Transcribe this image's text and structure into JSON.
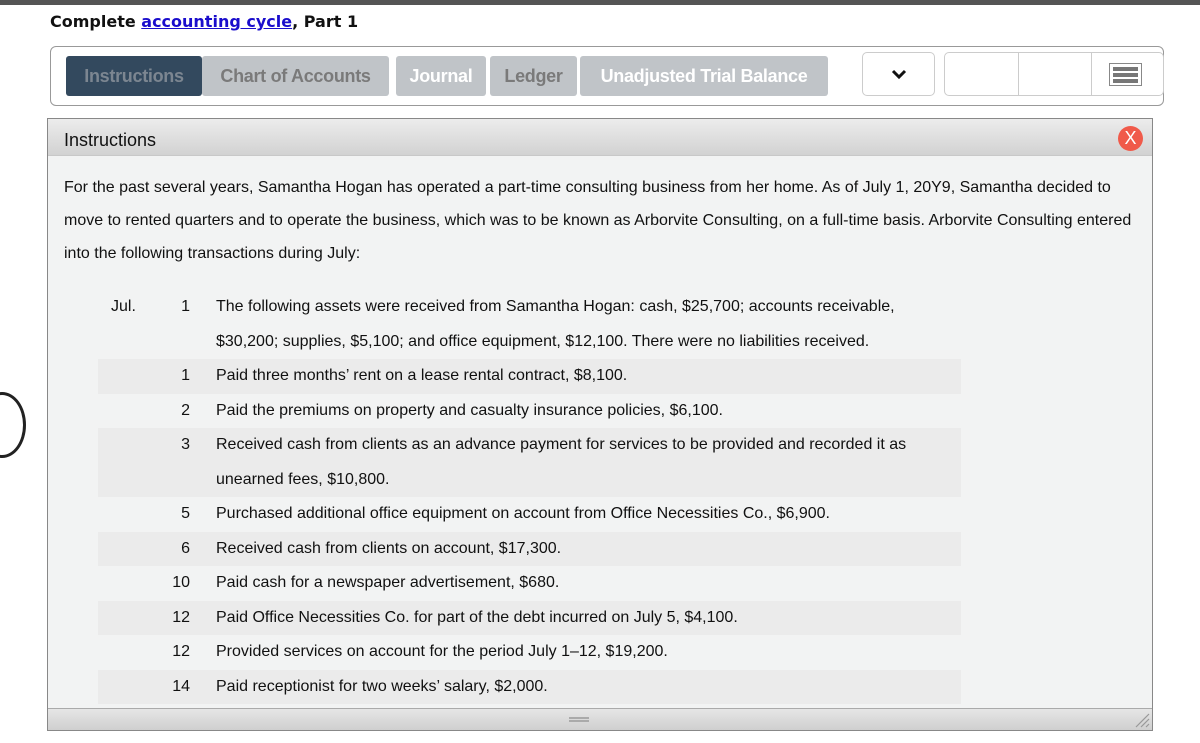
{
  "header": {
    "title_prefix": "Complete ",
    "title_link": "accounting cycle",
    "title_suffix": ", Part 1"
  },
  "tabs": [
    {
      "label": "Instructions",
      "active": true
    },
    {
      "label": "Chart of Accounts"
    },
    {
      "label": "Journal"
    },
    {
      "label": "Ledger"
    },
    {
      "label": "Unadjusted Trial Balance"
    }
  ],
  "panel": {
    "title": "Instructions",
    "close_label": "X",
    "intro": "For the past several years, Samantha Hogan has operated a part-time consulting business from her home. As of July 1, 20Y9, Samantha decided to move to rented quarters and to operate the business, which was to be known as Arborvite Consulting, on a full-time basis. Arborvite Consulting entered into the following transactions during July:",
    "transactions": [
      {
        "month": "Jul.",
        "day": "1",
        "text": "The following assets were received from Samantha Hogan: cash, $25,700; accounts receivable, $30,200; supplies, $5,100; and office equipment, $12,100. There were no liabilities received."
      },
      {
        "month": "",
        "day": "1",
        "text": "Paid three months’ rent on a lease rental contract, $8,100."
      },
      {
        "month": "",
        "day": "2",
        "text": "Paid the premiums on property and casualty insurance policies, $6,100."
      },
      {
        "month": "",
        "day": "3",
        "text": "Received cash from clients as an advance payment for services to be provided and recorded it as unearned fees, $10,800."
      },
      {
        "month": "",
        "day": "5",
        "text": "Purchased additional office equipment on account from Office Necessities Co., $6,900."
      },
      {
        "month": "",
        "day": "6",
        "text": "Received cash from clients on account, $17,300."
      },
      {
        "month": "",
        "day": "10",
        "text": "Paid cash for a newspaper advertisement, $680."
      },
      {
        "month": "",
        "day": "12",
        "text": "Paid Office Necessities Co. for part of the debt incurred on July 5, $4,100."
      },
      {
        "month": "",
        "day": "12",
        "text": "Provided services on account for the period July 1–12, $19,200."
      },
      {
        "month": "",
        "day": "14",
        "text": "Paid receptionist for two weeks’ salary, $2,000."
      }
    ]
  },
  "colors": {
    "active_tab": "#33495e",
    "inactive_tab": "#c0c4c8",
    "close": "#f05a4a",
    "link": "#1a0dcc"
  }
}
